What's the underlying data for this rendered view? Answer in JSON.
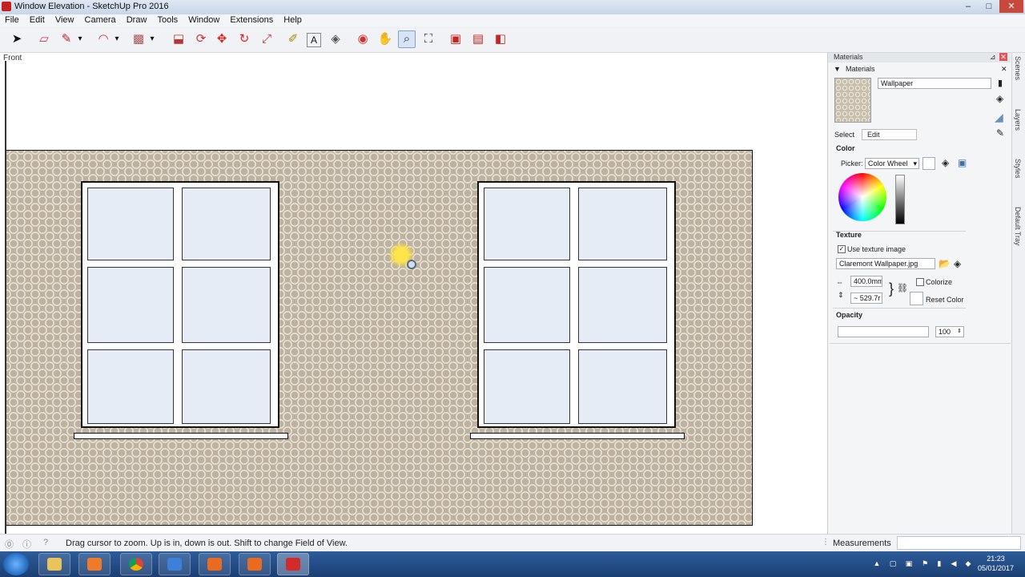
{
  "window": {
    "title": "Window Elevation - SketchUp Pro 2016",
    "controls": [
      "–",
      "□",
      "✕"
    ]
  },
  "menu": [
    "File",
    "Edit",
    "View",
    "Camera",
    "Draw",
    "Tools",
    "Window",
    "Extensions",
    "Help"
  ],
  "toolbar": {
    "tools": [
      {
        "name": "select",
        "icon": "arrow-icon",
        "glyph": "➤"
      },
      {
        "name": "eraser",
        "icon": "eraser-icon",
        "glyph": "▱"
      },
      {
        "name": "line",
        "icon": "pencil-icon",
        "glyph": "✎"
      },
      {
        "name": "line-dropdown",
        "icon": "chevron-down-icon",
        "glyph": "▾"
      },
      {
        "name": "arc",
        "icon": "arc-icon",
        "glyph": "◠"
      },
      {
        "name": "arc-dropdown",
        "icon": "chevron-down-icon",
        "glyph": "▾"
      },
      {
        "name": "rectangle",
        "icon": "rectangle-icon",
        "glyph": "▩"
      },
      {
        "name": "rectangle-dropdown",
        "icon": "chevron-down-icon",
        "glyph": "▾"
      },
      {
        "name": "push-pull",
        "icon": "push-pull-icon",
        "glyph": "⬓"
      },
      {
        "name": "offset",
        "icon": "offset-icon",
        "glyph": "⟳"
      },
      {
        "name": "move",
        "icon": "move-icon",
        "glyph": "✥"
      },
      {
        "name": "rotate",
        "icon": "rotate-icon",
        "glyph": "↻"
      },
      {
        "name": "scale",
        "icon": "scale-icon",
        "glyph": "⤢"
      },
      {
        "name": "tape-measure",
        "icon": "tape-measure-icon",
        "glyph": "✐"
      },
      {
        "name": "text",
        "icon": "text-icon",
        "glyph": "A"
      },
      {
        "name": "paint-bucket",
        "icon": "paint-bucket-icon",
        "glyph": "◈"
      },
      {
        "name": "orbit",
        "icon": "orbit-icon",
        "glyph": "◉"
      },
      {
        "name": "pan",
        "icon": "hand-icon",
        "glyph": "✋"
      },
      {
        "name": "zoom",
        "icon": "magnifier-icon",
        "glyph": "⌕"
      },
      {
        "name": "zoom-extents",
        "icon": "zoom-extents-icon",
        "glyph": "⛶"
      },
      {
        "name": "3d-warehouse",
        "icon": "warehouse-icon",
        "glyph": "▣"
      },
      {
        "name": "extension-warehouse",
        "icon": "extension-warehouse-icon",
        "glyph": "▤"
      },
      {
        "name": "layout",
        "icon": "layout-icon",
        "glyph": "◧"
      }
    ],
    "active": "zoom"
  },
  "canvas": {
    "view_label": "Front"
  },
  "tray": {
    "header": "Materials",
    "panel_title": "Materials",
    "material_name": "Wallpaper",
    "tab_select": "Select",
    "tab_edit": "Edit",
    "color_label": "Color",
    "picker_label": "Picker:",
    "picker_value": "Color Wheel",
    "texture_label": "Texture",
    "use_texture_label": "Use texture image",
    "use_texture_checked": true,
    "texture_file": "Claremont Wallpaper.jpg",
    "width_value": "400.0mm",
    "height_value": "~ 529.7r",
    "colorize_label": "Colorize",
    "reset_color_label": "Reset Color",
    "opacity_label": "Opacity",
    "opacity_value": "100"
  },
  "side_tabs": [
    "Scenes",
    "Layers",
    "Styles",
    "Default Tray"
  ],
  "status": {
    "hint": "Drag cursor to zoom.  Up is in, down is out. Shift to change Field of View.",
    "measurements_label": "Measurements"
  },
  "taskbar": {
    "time": "21:23",
    "date": "05/01/2017"
  }
}
